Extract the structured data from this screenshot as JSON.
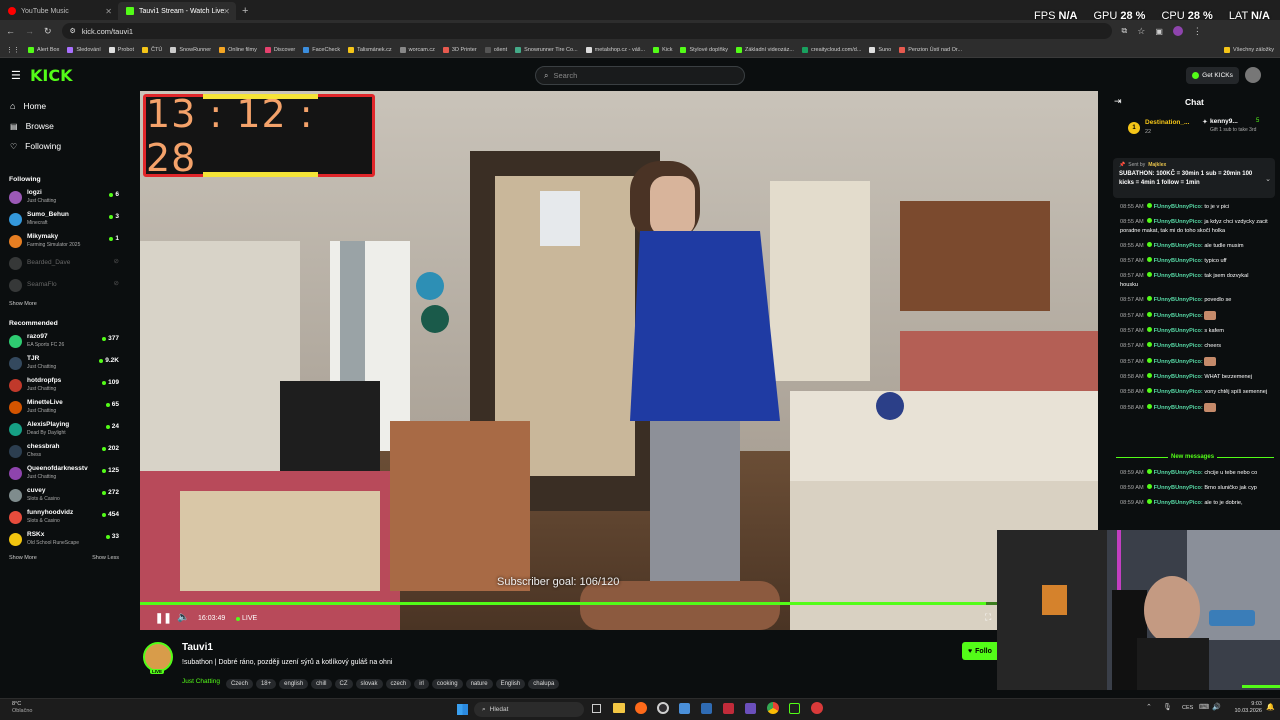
{
  "browser": {
    "tabs": [
      {
        "label": "YouTube Music",
        "color": "#ff0000"
      },
      {
        "label": "Tauvi1 Stream - Watch Live",
        "color": "#53fc18"
      }
    ],
    "url": "kick.com/tauvi1"
  },
  "perf_overlay": [
    {
      "label": "FPS",
      "value": "N/A"
    },
    {
      "label": "GPU",
      "value": "28 %"
    },
    {
      "label": "CPU",
      "value": "28 %"
    },
    {
      "label": "LAT",
      "value": "N/A"
    }
  ],
  "bookmarks": [
    {
      "label": "Alert Box",
      "color": "#53fc18"
    },
    {
      "label": "Sledování",
      "color": "#a970ff"
    },
    {
      "label": "Probot",
      "color": "#e0e0e0"
    },
    {
      "label": "ČTÚ",
      "color": "#f5c518"
    },
    {
      "label": "SnowRunner",
      "color": "#cccccc"
    },
    {
      "label": "Online filmy",
      "color": "#f5a623"
    },
    {
      "label": "Discover",
      "color": "#e6416e"
    },
    {
      "label": "FaceCheck",
      "color": "#3b8ede"
    },
    {
      "label": "Talismánek.cz",
      "color": "#f5c518"
    },
    {
      "label": "worcam.cz",
      "color": "#888888"
    },
    {
      "label": "3D Printer",
      "color": "#e85a4f"
    },
    {
      "label": "ošent",
      "color": "#555555"
    },
    {
      "label": "Snowrunner Tire Co...",
      "color": "#4a8"
    },
    {
      "label": "metalshop.cz - váš...",
      "color": "#ddd"
    },
    {
      "label": "Kick",
      "color": "#53fc18"
    },
    {
      "label": "Stylové doplňky",
      "color": "#53fc18"
    },
    {
      "label": "Základní videozáz...",
      "color": "#53fc18"
    },
    {
      "label": "creaitycloud.com/d...",
      "color": "#19a15f"
    },
    {
      "label": "Suno",
      "color": "#e0e0e0"
    },
    {
      "label": "Penzion Ústí nad Or...",
      "color": "#e85a4f"
    },
    {
      "label": "Všechny záložky",
      "color": "#f5c518"
    }
  ],
  "header": {
    "logo": "KICK",
    "search_placeholder": "Search",
    "get_kicks_label": "Get KICKs"
  },
  "nav": [
    {
      "label": "Home"
    },
    {
      "label": "Browse"
    },
    {
      "label": "Following"
    }
  ],
  "following": {
    "title": "Following",
    "channels": [
      {
        "name": "logzi",
        "category": "Just Chatting",
        "viewers": "6",
        "online": true,
        "color": "#9b59b6"
      },
      {
        "name": "Sumo_Behun",
        "category": "Minecraft",
        "viewers": "3",
        "online": true,
        "color": "#3498db"
      },
      {
        "name": "Mikymaky",
        "category": "Farming Simulator 2025",
        "viewers": "1",
        "online": true,
        "color": "#e67e22"
      },
      {
        "name": "Bearded_Dave",
        "category": "",
        "viewers": "",
        "online": false,
        "color": "#888888"
      },
      {
        "name": "SeamaFlo",
        "category": "",
        "viewers": "",
        "online": false,
        "color": "#888888"
      }
    ],
    "show_more": "Show More"
  },
  "recommended": {
    "title": "Recommended",
    "channels": [
      {
        "name": "razo97",
        "category": "EA Sports FC 26",
        "viewers": "377",
        "color": "#2ecc71"
      },
      {
        "name": "TJR",
        "category": "Just Chatting",
        "viewers": "9.2K",
        "color": "#34495e"
      },
      {
        "name": "hotdropfps",
        "category": "Just Chatting",
        "viewers": "109",
        "color": "#c0392b"
      },
      {
        "name": "MinetteLive",
        "category": "Just Chatting",
        "viewers": "65",
        "color": "#d35400"
      },
      {
        "name": "AlexisPlaying",
        "category": "Dead By Daylight",
        "viewers": "24",
        "color": "#16a085"
      },
      {
        "name": "chessbrah",
        "category": "Chess",
        "viewers": "202",
        "color": "#2c3e50"
      },
      {
        "name": "Queenofdarknesstv",
        "category": "Just Chatting",
        "viewers": "125",
        "color": "#8e44ad"
      },
      {
        "name": "cuvey",
        "category": "Slots & Casino",
        "viewers": "272",
        "color": "#7f8c8d"
      },
      {
        "name": "funnyhoodvidz",
        "category": "Slots & Casino",
        "viewers": "454",
        "color": "#e74c3c"
      },
      {
        "name": "RSKx",
        "category": "Old School RuneScape",
        "viewers": "33",
        "color": "#f1c40f"
      }
    ],
    "show_more": "Show More",
    "show_less": "Show Less"
  },
  "player": {
    "timer": "13 : 12 : 28",
    "subscriber_goal": "Subscriber goal: 106/120",
    "time": "16:03:49",
    "live_label": "LIVE"
  },
  "chat": {
    "title": "Chat",
    "pinned_left": {
      "name": "Destination_...",
      "count": "22"
    },
    "pinned_right": {
      "name": "kenny9...",
      "count": "5",
      "note": "Gift 1 sub to take 3rd"
    },
    "pinned_message": {
      "sent_by": "Sent by",
      "user": "Majklex",
      "text": "SUBATHON: 100KČ = 30min 1 sub = 20min 100 kicks = 4min 1 follow = 1min"
    },
    "messages": [
      {
        "time": "08:55 AM",
        "user": "FUnnyBUnnyPico:",
        "text": "to je v pici"
      },
      {
        "time": "08:55 AM",
        "user": "FUnnyBUnnyPico:",
        "text": "ja kdyz chci vzdycky zacit poradne makat, tak mi do toho skočí holka"
      },
      {
        "time": "08:55 AM",
        "user": "FUnnyBUnnyPico:",
        "text": "ale tudle musim"
      },
      {
        "time": "08:57 AM",
        "user": "FUnnyBUnnyPico:",
        "text": "typico uff"
      },
      {
        "time": "08:57 AM",
        "user": "FUnnyBUnnyPico:",
        "text": "tak jsem dozvykal housku"
      },
      {
        "time": "08:57 AM",
        "user": "FUnnyBUnnyPico:",
        "text": "povedlo se"
      },
      {
        "time": "08:57 AM",
        "user": "FUnnyBUnnyPico:",
        "text": "",
        "emote": true
      },
      {
        "time": "08:57 AM",
        "user": "FUnnyBUnnyPico:",
        "text": "s kafem"
      },
      {
        "time": "08:57 AM",
        "user": "FUnnyBUnnyPico:",
        "text": "cheers"
      },
      {
        "time": "08:57 AM",
        "user": "FUnnyBUnnyPico:",
        "text": "",
        "emote": true
      },
      {
        "time": "08:58 AM",
        "user": "FUnnyBUnnyPico:",
        "text": "WHAT bezzemenej"
      },
      {
        "time": "08:58 AM",
        "user": "FUnnyBUnnyPico:",
        "text": "vony chtěj spíš semennej"
      },
      {
        "time": "08:58 AM",
        "user": "FUnnyBUnnyPico:",
        "text": "",
        "emote": true
      }
    ],
    "new_messages_label": "New messages",
    "new_messages": [
      {
        "time": "08:59 AM",
        "user": "FUnnyBUnnyPico:",
        "text": "chcije u tebe nebo co"
      },
      {
        "time": "08:59 AM",
        "user": "FUnnyBUnnyPico:",
        "text": "Brno sluničko jak cyp"
      },
      {
        "time": "08:59 AM",
        "user": "FUnnyBUnnyPico:",
        "text": "ale to je dobrie,"
      }
    ]
  },
  "stream": {
    "channel": "Tauvi1",
    "title": "!subathon | Dobré ráno, později uzení sýrů a kotlíkový guláš na ohni",
    "category": "Just Chatting",
    "tags": [
      "Czech",
      "18+",
      "english",
      "chill",
      "CZ",
      "slovak",
      "czech",
      "irl",
      "cooking",
      "nature",
      "English",
      "chalupa"
    ],
    "follow_label": "Follo",
    "live_badge": "LIVE"
  },
  "taskbar": {
    "weather_temp": "8°C",
    "weather_text": "Oblačno",
    "search_label": "Hledat",
    "lang": "CES",
    "time": "9:03",
    "date": "10.03.2026"
  }
}
